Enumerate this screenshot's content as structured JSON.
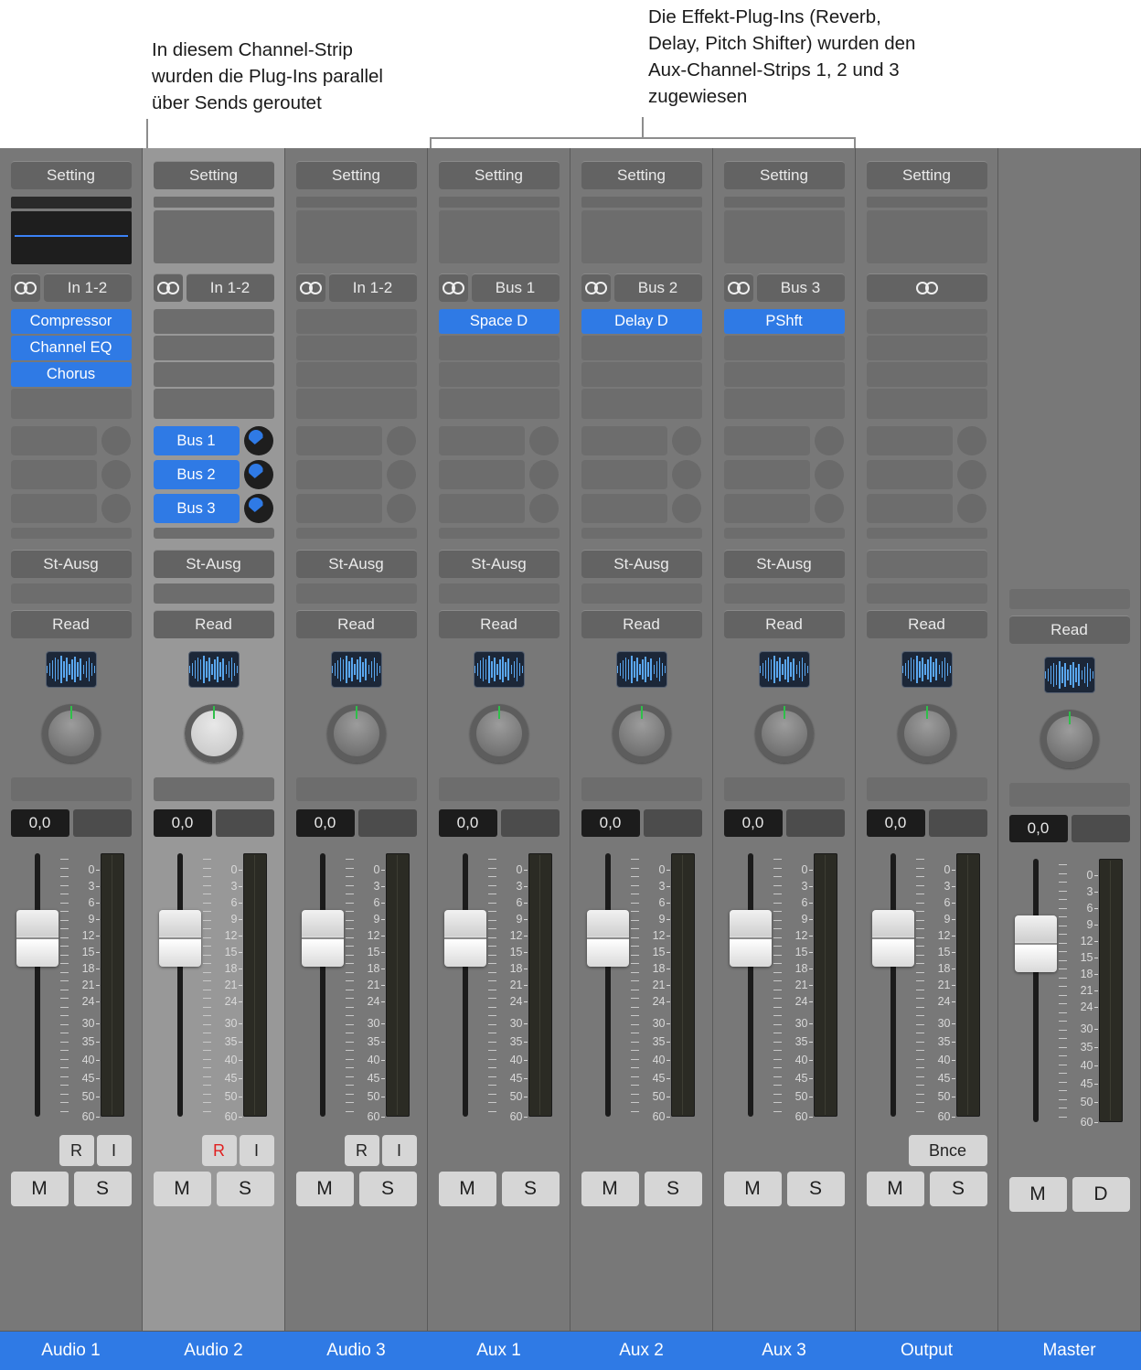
{
  "annotations": {
    "left": "In diesem Channel-Strip\nwurden die Plug-Ins parallel\nüber Sends geroutet",
    "right": "Die Effekt-Plug-Ins (Reverb,\nDelay, Pitch Shifter) wurden den\nAux-Channel-Strips 1, 2 und 3\nzugewiesen"
  },
  "common": {
    "setting_label": "Setting",
    "output_label": "St-Ausg",
    "automation_label": "Read",
    "gain_value": "0,0",
    "mute_label": "M",
    "solo_label": "S",
    "record_label": "R",
    "input_monitor_label": "I",
    "bounce_label": "Bnce",
    "dim_label": "D",
    "stereo_icon": "stereo-circles-icon",
    "wave_icon": "waveform-icon"
  },
  "scale_labels": [
    "0",
    "3",
    "6",
    "9",
    "12",
    "15",
    "18",
    "21",
    "24",
    "30",
    "35",
    "40",
    "45",
    "50",
    "60"
  ],
  "colors": {
    "accent_blue": "#2f7ae5",
    "strip_bg": "#787878",
    "strip_selected_bg": "#989898",
    "button_bg": "#636363",
    "name_plate": "#2f7ae5",
    "record_red": "#e02020",
    "knob_tick_green": "#2fbf4a"
  },
  "strips": [
    {
      "id": "audio-1",
      "name": "Audio 1",
      "selected": false,
      "setting": "Setting",
      "eq_display": true,
      "input": "In 1-2",
      "has_input_label": true,
      "inserts": [
        {
          "label": "Compressor",
          "active": true
        },
        {
          "label": "Channel EQ",
          "active": true
        },
        {
          "label": "Chorus",
          "active": true
        }
      ],
      "sends": [
        {
          "label": "",
          "active": false,
          "knob_on": false
        },
        {
          "label": "",
          "active": false,
          "knob_on": false
        },
        {
          "label": "",
          "active": false,
          "knob_on": false
        }
      ],
      "output": "St-Ausg",
      "automation": "Read",
      "knob_light": false,
      "gain": "0,0",
      "ri_buttons": [
        "R",
        "I"
      ],
      "record_armed": false,
      "ms_buttons": [
        "M",
        "S"
      ],
      "show_bounce": false
    },
    {
      "id": "audio-2",
      "name": "Audio 2",
      "selected": true,
      "setting": "Setting",
      "eq_display": false,
      "input": "In 1-2",
      "has_input_label": true,
      "inserts": [
        {
          "label": "",
          "active": false
        },
        {
          "label": "",
          "active": false
        },
        {
          "label": "",
          "active": false
        }
      ],
      "sends": [
        {
          "label": "Bus 1",
          "active": true,
          "knob_on": true
        },
        {
          "label": "Bus 2",
          "active": true,
          "knob_on": true
        },
        {
          "label": "Bus 3",
          "active": true,
          "knob_on": true
        }
      ],
      "output": "St-Ausg",
      "automation": "Read",
      "knob_light": true,
      "gain": "0,0",
      "ri_buttons": [
        "R",
        "I"
      ],
      "record_armed": true,
      "ms_buttons": [
        "M",
        "S"
      ],
      "show_bounce": false
    },
    {
      "id": "audio-3",
      "name": "Audio 3",
      "selected": false,
      "setting": "Setting",
      "eq_display": false,
      "input": "In 1-2",
      "has_input_label": true,
      "inserts": [
        {
          "label": "",
          "active": false
        },
        {
          "label": "",
          "active": false
        },
        {
          "label": "",
          "active": false
        }
      ],
      "sends": [
        {
          "label": "",
          "active": false,
          "knob_on": false
        },
        {
          "label": "",
          "active": false,
          "knob_on": false
        },
        {
          "label": "",
          "active": false,
          "knob_on": false
        }
      ],
      "output": "St-Ausg",
      "automation": "Read",
      "knob_light": false,
      "gain": "0,0",
      "ri_buttons": [
        "R",
        "I"
      ],
      "record_armed": false,
      "ms_buttons": [
        "M",
        "S"
      ],
      "show_bounce": false
    },
    {
      "id": "aux-1",
      "name": "Aux 1",
      "selected": false,
      "setting": "Setting",
      "eq_display": false,
      "input": "Bus 1",
      "has_input_label": true,
      "inserts": [
        {
          "label": "Space D",
          "active": true
        },
        {
          "label": "",
          "active": false
        },
        {
          "label": "",
          "active": false
        }
      ],
      "sends": [
        {
          "label": "",
          "active": false,
          "knob_on": false
        },
        {
          "label": "",
          "active": false,
          "knob_on": false
        },
        {
          "label": "",
          "active": false,
          "knob_on": false
        }
      ],
      "output": "St-Ausg",
      "automation": "Read",
      "knob_light": false,
      "gain": "0,0",
      "ri_buttons": [],
      "record_armed": false,
      "ms_buttons": [
        "M",
        "S"
      ],
      "show_bounce": false
    },
    {
      "id": "aux-2",
      "name": "Aux 2",
      "selected": false,
      "setting": "Setting",
      "eq_display": false,
      "input": "Bus 2",
      "has_input_label": true,
      "inserts": [
        {
          "label": "Delay D",
          "active": true
        },
        {
          "label": "",
          "active": false
        },
        {
          "label": "",
          "active": false
        }
      ],
      "sends": [
        {
          "label": "",
          "active": false,
          "knob_on": false
        },
        {
          "label": "",
          "active": false,
          "knob_on": false
        },
        {
          "label": "",
          "active": false,
          "knob_on": false
        }
      ],
      "output": "St-Ausg",
      "automation": "Read",
      "knob_light": false,
      "gain": "0,0",
      "ri_buttons": [],
      "record_armed": false,
      "ms_buttons": [
        "M",
        "S"
      ],
      "show_bounce": false
    },
    {
      "id": "aux-3",
      "name": "Aux 3",
      "selected": false,
      "setting": "Setting",
      "eq_display": false,
      "input": "Bus 3",
      "has_input_label": true,
      "inserts": [
        {
          "label": "PShft",
          "active": true
        },
        {
          "label": "",
          "active": false
        },
        {
          "label": "",
          "active": false
        }
      ],
      "sends": [
        {
          "label": "",
          "active": false,
          "knob_on": false
        },
        {
          "label": "",
          "active": false,
          "knob_on": false
        },
        {
          "label": "",
          "active": false,
          "knob_on": false
        }
      ],
      "output": "St-Ausg",
      "automation": "Read",
      "knob_light": false,
      "gain": "0,0",
      "ri_buttons": [],
      "record_armed": false,
      "ms_buttons": [
        "M",
        "S"
      ],
      "show_bounce": false
    },
    {
      "id": "output",
      "name": "Output",
      "selected": false,
      "setting": "Setting",
      "eq_display": false,
      "input": "",
      "has_input_label": false,
      "inserts": [
        {
          "label": "",
          "active": false
        },
        {
          "label": "",
          "active": false
        },
        {
          "label": "",
          "active": false
        }
      ],
      "sends": [
        {
          "label": "",
          "active": false,
          "knob_on": false
        },
        {
          "label": "",
          "active": false,
          "knob_on": false
        },
        {
          "label": "",
          "active": false,
          "knob_on": false
        }
      ],
      "output": "",
      "automation": "Read",
      "knob_light": false,
      "gain": "0,0",
      "ri_buttons": [],
      "record_armed": false,
      "ms_buttons": [
        "M",
        "S"
      ],
      "show_bounce": true
    },
    {
      "id": "master",
      "name": "Master",
      "selected": false,
      "setting": "",
      "eq_display": false,
      "input": "",
      "has_input_label": false,
      "inserts": [],
      "sends": [],
      "output": "",
      "automation": "Read",
      "knob_light": false,
      "gain": "0,0",
      "ri_buttons": [],
      "record_armed": false,
      "ms_buttons": [
        "M",
        "D"
      ],
      "show_bounce": false
    }
  ]
}
